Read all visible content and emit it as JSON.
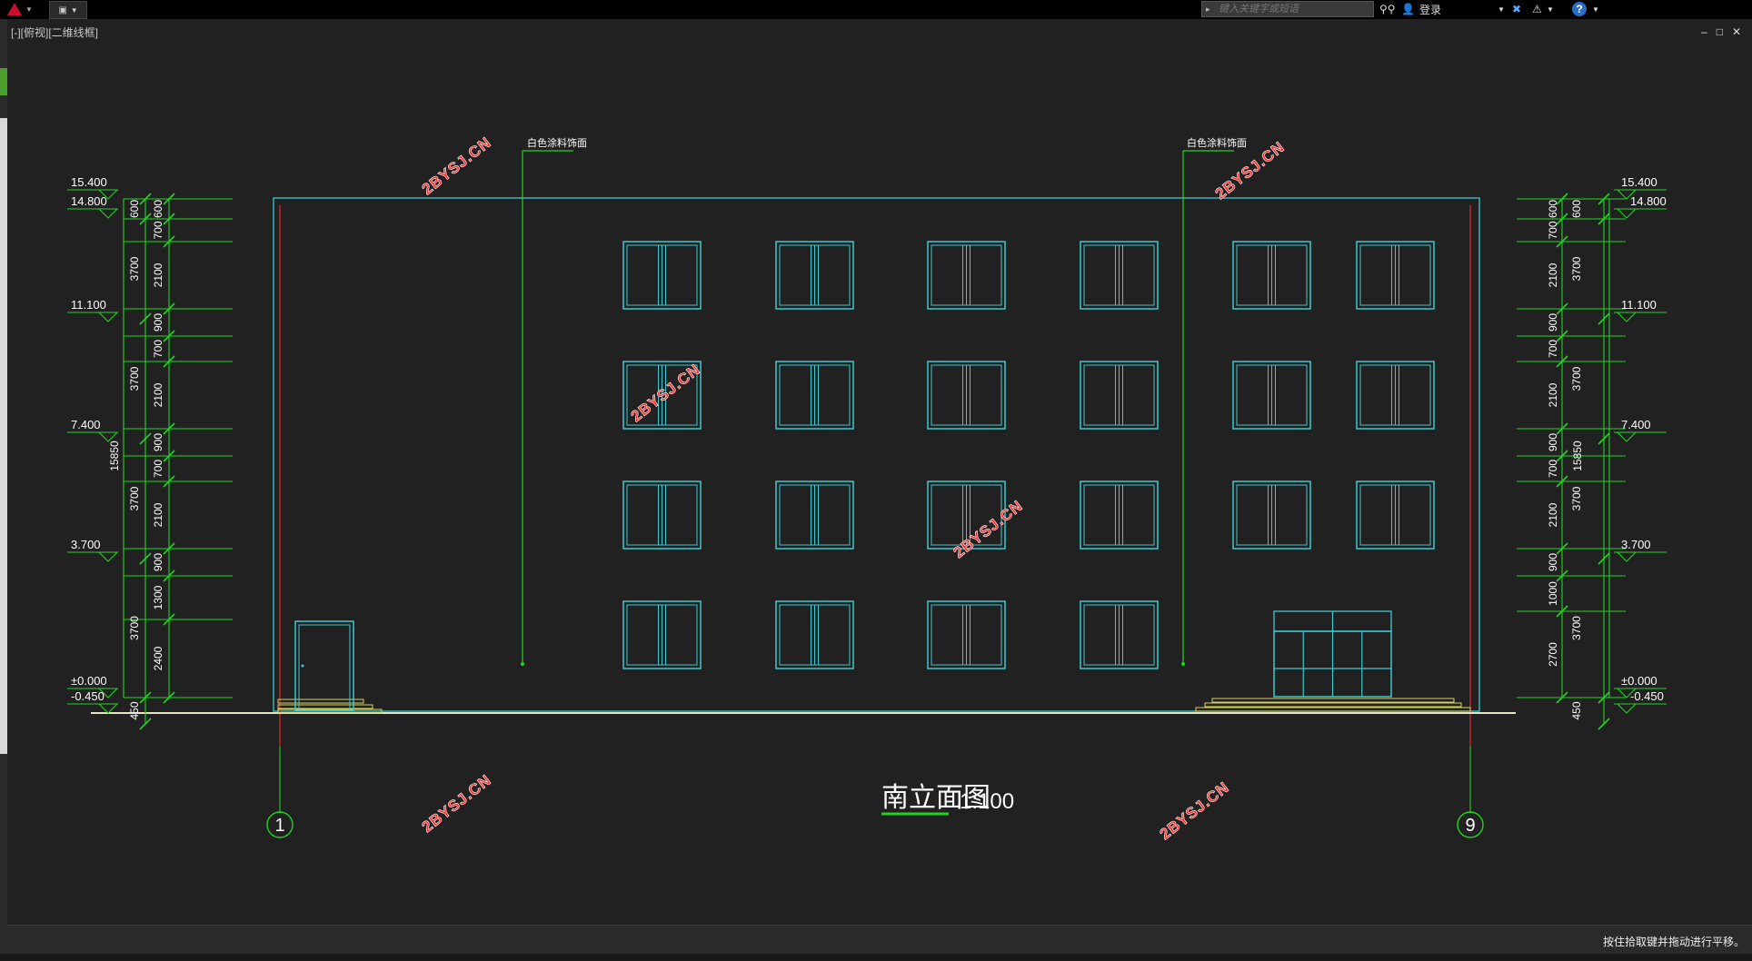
{
  "toolbar": {
    "search_placeholder": "键入关键字或短语",
    "login_label": "登录"
  },
  "viewport_label": "[-][俯视][二维线框]",
  "window_controls": [
    "–",
    "□",
    "✕"
  ],
  "status_message": "按住拾取键并拖动进行平移。",
  "drawing": {
    "title": "南立面图",
    "scale": "1:100",
    "callout_left": "白色涂料饰面",
    "callout_right": "白色涂料饰面",
    "axis_left": "1",
    "axis_right": "9",
    "watermark": "2BYSJ.CN",
    "elevations": [
      "15.400",
      "14.800",
      "11.100",
      "7.400",
      "3.700",
      "±0.000",
      "-0.450"
    ],
    "dims_left_outer": [
      "600",
      "3700",
      "3700",
      "3700",
      "3700",
      "450"
    ],
    "dims_left_inner": [
      "600",
      "700",
      "2100",
      "900",
      "700",
      "2100",
      "900",
      "700",
      "2100",
      "900",
      "1300",
      "2400"
    ],
    "dims_right_outer": [
      "600",
      "3700",
      "3700",
      "3700",
      "3700",
      "450"
    ],
    "dims_right_inner": [
      "600",
      "700",
      "2100",
      "900",
      "700",
      "2100",
      "900",
      "700",
      "2100",
      "900",
      "1000",
      "2700"
    ],
    "total_height": "15850"
  },
  "colors": {
    "background": "#212121",
    "outline": "#3fc8d0",
    "dims": "#22d322",
    "axis_red": "#c0262b",
    "ground": "#e9e6c7",
    "stairs": "#d8d25a",
    "watermark": "#ff2b2b"
  }
}
